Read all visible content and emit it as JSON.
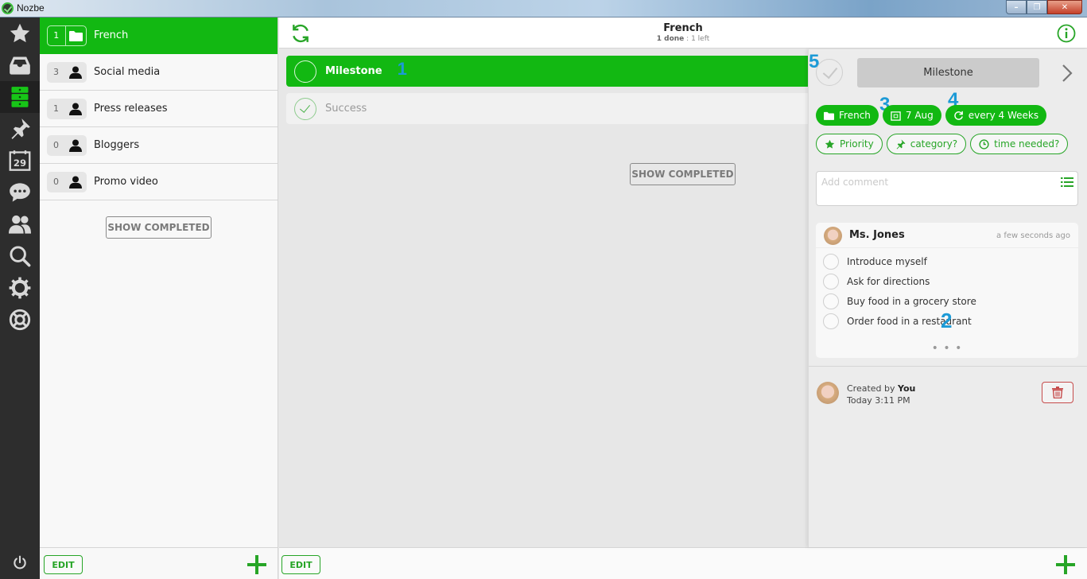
{
  "window": {
    "title": "Nozbe",
    "controls": {
      "minimize": "–",
      "maximize": "❐",
      "close": "✕"
    }
  },
  "rail": {
    "items": [
      {
        "name": "priority",
        "icon": "star-icon"
      },
      {
        "name": "inbox",
        "icon": "inbox-tray-icon"
      },
      {
        "name": "projects",
        "icon": "projects-stack-icon",
        "active": true
      },
      {
        "name": "categories",
        "icon": "pin-icon"
      },
      {
        "name": "calendar",
        "icon": "calendar-icon",
        "label": "29"
      },
      {
        "name": "comments",
        "icon": "chat-bubble-icon"
      },
      {
        "name": "team",
        "icon": "team-icon"
      },
      {
        "name": "search",
        "icon": "search-icon"
      },
      {
        "name": "settings",
        "icon": "gear-icon"
      },
      {
        "name": "help",
        "icon": "lifebuoy-icon"
      }
    ],
    "power_icon": "power-icon"
  },
  "projects": {
    "items": [
      {
        "count": "1",
        "name": "French",
        "icon": "folder-icon",
        "active": true
      },
      {
        "count": "3",
        "name": "Social media",
        "icon": "person-icon"
      },
      {
        "count": "1",
        "name": "Press releases",
        "icon": "person-icon"
      },
      {
        "count": "0",
        "name": "Bloggers",
        "icon": "person-icon"
      },
      {
        "count": "0",
        "name": "Promo video",
        "icon": "person-icon"
      }
    ],
    "show_completed_label": "SHOW COMPLETED",
    "edit_label": "EDIT"
  },
  "main": {
    "title": "French",
    "done_label": "1 done",
    "separator": ":",
    "left_label": "1 left",
    "tasks": [
      {
        "name": "Milestone",
        "status": "active"
      },
      {
        "name": "Success",
        "status": "completed"
      }
    ],
    "show_completed_label": "SHOW COMPLETED",
    "edit_label": "EDIT"
  },
  "annotations": {
    "a1": "1",
    "a2": "2",
    "a3": "3",
    "a4": "4",
    "a5": "5"
  },
  "details": {
    "task_name": "Milestone",
    "chips_solid": [
      {
        "label": "French",
        "icon": "folder-icon"
      },
      {
        "label": "7 Aug",
        "icon": "calendar-icon"
      },
      {
        "label": "every 4 Weeks",
        "icon": "repeat-icon"
      }
    ],
    "chips_outline": [
      {
        "label": "Priority",
        "icon": "star-icon"
      },
      {
        "label": "category?",
        "icon": "pin-icon"
      },
      {
        "label": "time needed?",
        "icon": "clock-icon"
      }
    ],
    "comment_placeholder": "Add comment",
    "comment": {
      "author": "Ms. Jones",
      "time": "a few seconds ago",
      "checklist": [
        "Introduce myself",
        "Ask for directions",
        "Buy food in a grocery store",
        "Order food in a restaurant"
      ],
      "more": "• • •"
    },
    "created_by_prefix": "Created by",
    "created_by_name": "You",
    "created_at": "Today 3:11 PM"
  },
  "colors": {
    "accent": "#12b812",
    "accent_dark": "#27a527",
    "rail_bg": "#2d2d2d",
    "danger": "#c64b4b",
    "annotation": "#1c9ad6"
  }
}
